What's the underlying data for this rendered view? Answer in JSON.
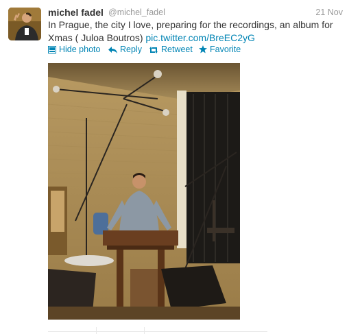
{
  "tweet": {
    "fullname": "michel fadel",
    "username": "@michel_fadel",
    "time": "21 Nov",
    "text_line1": "In Prague, the city I love, preparing for the recordings, an album for",
    "text_line2": "Xmas ( Juloa Boutros)",
    "link": "pic.twitter.com/BreEC2yG"
  },
  "actions": {
    "hide_photo": "Hide photo",
    "reply": "Reply",
    "retweet": "Retweet",
    "favorite": "Favorite"
  },
  "colors": {
    "link": "#0084b4",
    "name": "#333333",
    "meta": "#999999"
  },
  "icons": {
    "hide_photo": "photo-icon",
    "reply": "reply-arrow-icon",
    "retweet": "retweet-icon",
    "favorite": "star-icon"
  }
}
